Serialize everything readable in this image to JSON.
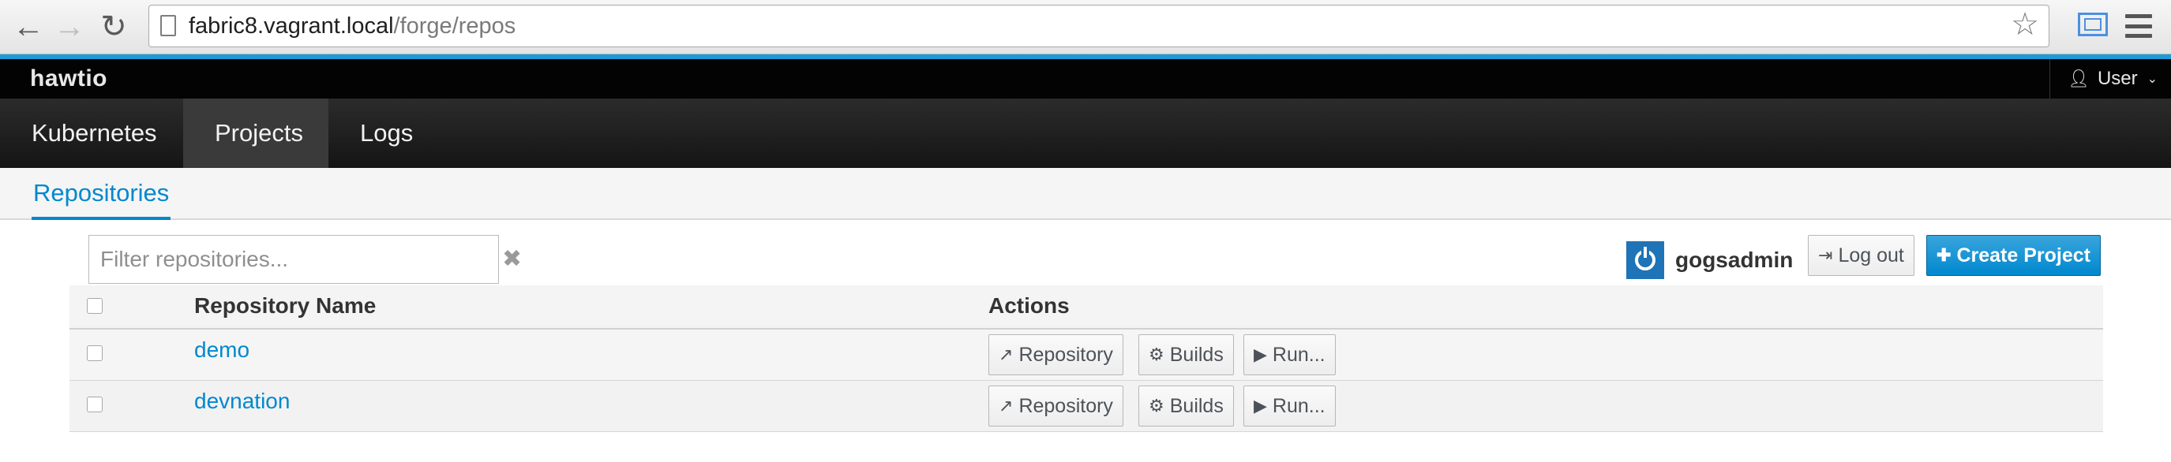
{
  "browser": {
    "url_host": "fabric8.vagrant.local",
    "url_path": "/forge/repos",
    "back_icon": "arrow-left-icon",
    "forward_icon": "arrow-right-icon",
    "reload_icon": "reload-icon"
  },
  "app": {
    "logo_text": "hawtio",
    "user_label": "User"
  },
  "mainnav": {
    "items": [
      {
        "label": "Kubernetes",
        "active": false
      },
      {
        "label": "Projects",
        "active": true
      },
      {
        "label": "Logs",
        "active": false
      }
    ]
  },
  "subnav": {
    "active_tab": "Repositories"
  },
  "filter": {
    "placeholder": "Filter repositories...",
    "value": ""
  },
  "account": {
    "name": "gogsadmin",
    "logout_label": "Log out",
    "create_label": "Create Project"
  },
  "table": {
    "headers": {
      "name": "Repository Name",
      "actions": "Actions"
    },
    "rows": [
      {
        "name": "demo",
        "actions": [
          "Repository",
          "Builds",
          "Run..."
        ]
      },
      {
        "name": "devnation",
        "actions": [
          "Repository",
          "Builds",
          "Run..."
        ]
      }
    ]
  },
  "colors": {
    "accent": "#0088ce",
    "topbar": "#030303",
    "browser_accent": "#1d9bd8"
  }
}
